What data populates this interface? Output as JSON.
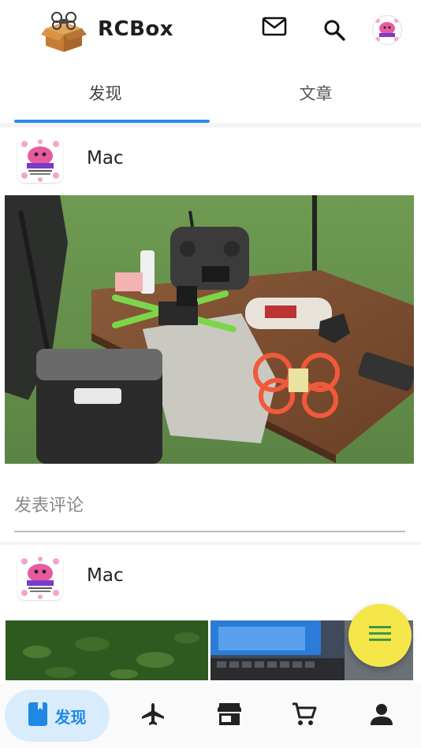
{
  "app": {
    "title": "RCBox",
    "brand_color": "#2e8be6",
    "fab_color": "#f5e64a"
  },
  "tabs": [
    {
      "label": "发现",
      "active": true
    },
    {
      "label": "文章",
      "active": false
    }
  ],
  "posts": [
    {
      "author": "Mac",
      "comment_placeholder": "发表评论"
    },
    {
      "author": "Mac"
    }
  ],
  "bottom_nav": {
    "items": [
      {
        "label": "发现",
        "icon": "book-icon",
        "active": true
      },
      {
        "icon": "airplane-icon"
      },
      {
        "icon": "store-icon"
      },
      {
        "icon": "cart-icon"
      },
      {
        "icon": "person-icon"
      }
    ]
  }
}
